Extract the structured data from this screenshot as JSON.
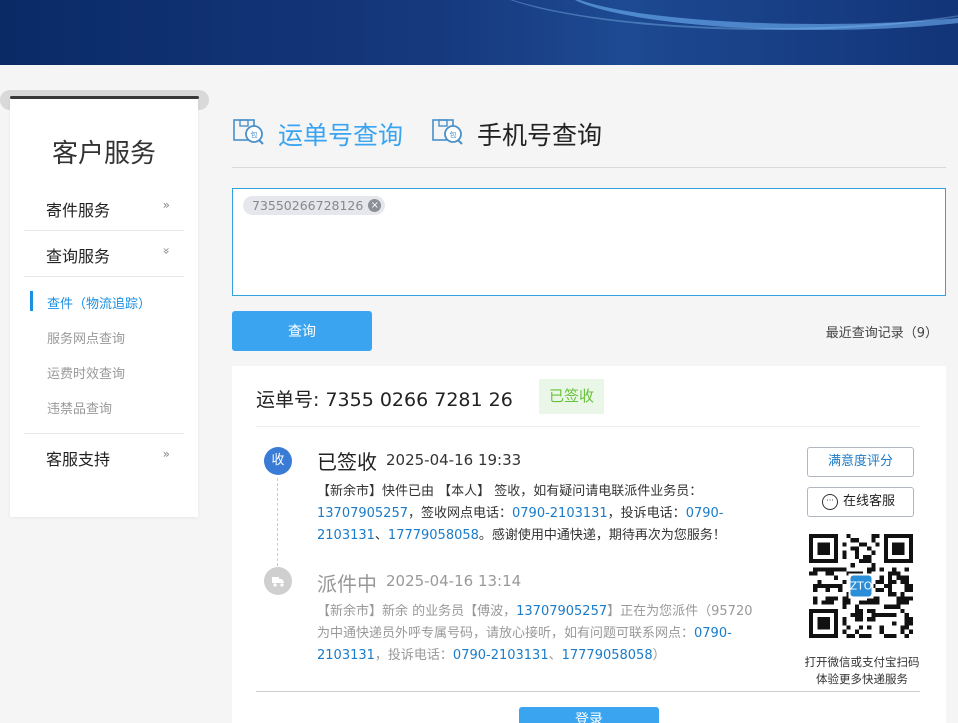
{
  "colors": {
    "accent": "#3aa4f0",
    "link": "#1a7bc9",
    "signed_green": "#67c23a",
    "banner": "#0a2a66"
  },
  "sidebar": {
    "title": "客户服务",
    "items": [
      {
        "label": "寄件服务",
        "chevron": "»"
      },
      {
        "label": "查询服务",
        "chevron": "»"
      },
      {
        "label": "客服支持",
        "chevron": "»"
      }
    ],
    "sub_items": [
      {
        "label": "查件（物流追踪）"
      },
      {
        "label": "服务网点查询"
      },
      {
        "label": "运费时效查询"
      },
      {
        "label": "违禁品查询"
      }
    ]
  },
  "tabs": [
    {
      "label": "运单号查询",
      "icon": "package-search-icon"
    },
    {
      "label": "手机号查询",
      "icon": "package-search-icon"
    }
  ],
  "search": {
    "chip": "73550266728126",
    "chip_remove": "×"
  },
  "actions": {
    "query": "查询",
    "recent": "最近查询记录（9）"
  },
  "result": {
    "waybill": "运单号: 7355 0266 7281 26",
    "status": "已签收",
    "events": [
      {
        "node": "收",
        "status": "已签收",
        "time": "2025-04-16 19:33",
        "d1": "【新余市】快件已由 【本人】 签收，如有疑问请电联派件业务员：",
        "phone1": "13707905257",
        "d2": "，签收网点电话：",
        "phone2": "0790-2103131",
        "d3": "，投诉电话：",
        "phone3": "0790-2103131",
        "d4": "、",
        "phone4": "17779058058",
        "d5": "。感谢使用中通快递，期待再次为您服务！"
      },
      {
        "node_icon": "delivery-truck-icon",
        "status": "派件中",
        "time": "2025-04-16 13:14",
        "d1": "【新余市】新余 的业务员【傅波，",
        "phone1": "13707905257",
        "d2": "】正在为您派件（95720为中通快递员外呼专属号码，请放心接听，如有问题可联系网点：",
        "phone2": "0790-2103131",
        "d3": "，投诉电话：",
        "phone3": "0790-2103131",
        "d4": "、",
        "phone4": "17779058058",
        "d5": "）"
      }
    ],
    "rate_button": "满意度评分",
    "service_button": "在线客服",
    "qr_caption_1": "打开微信或支付宝扫码",
    "qr_caption_2": "体验更多快递服务",
    "login_button": "登录"
  }
}
